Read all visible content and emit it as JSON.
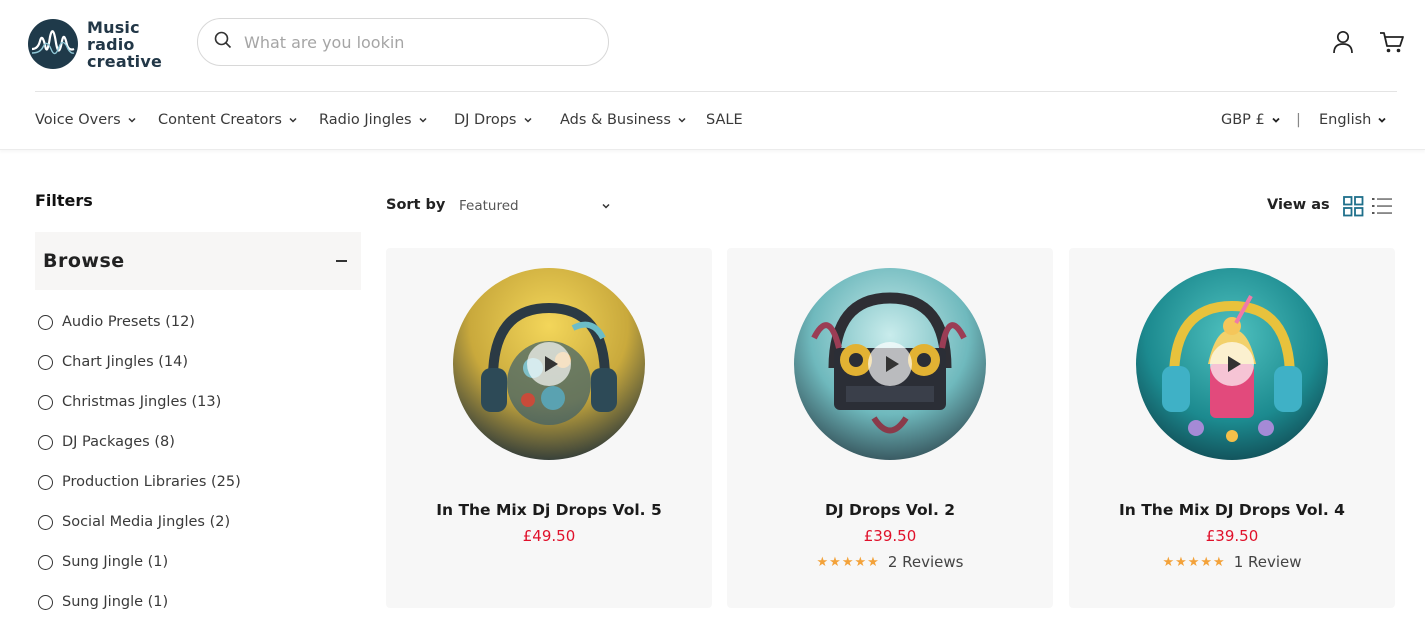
{
  "brand": {
    "logo_lines": [
      "Music",
      "radio",
      "creative"
    ],
    "accent": "#1f3a4a"
  },
  "search": {
    "placeholder": "What are you lookin"
  },
  "header_icons": [
    "account-icon",
    "cart-icon"
  ],
  "nav": {
    "items": [
      {
        "label": "Voice Overs",
        "dropdown": true
      },
      {
        "label": "Content Creators",
        "dropdown": true
      },
      {
        "label": "Radio Jingles",
        "dropdown": true
      },
      {
        "label": "DJ Drops",
        "dropdown": true
      },
      {
        "label": "Ads & Business",
        "dropdown": true
      },
      {
        "label": "SALE",
        "dropdown": false
      }
    ],
    "currency": "GBP £",
    "separator": "|",
    "language": "English"
  },
  "sidebar": {
    "filters_title": "Filters",
    "browse_title": "Browse",
    "items": [
      {
        "label": "Audio Presets (12)"
      },
      {
        "label": "Chart Jingles (14)"
      },
      {
        "label": "Christmas Jingles (13)"
      },
      {
        "label": "DJ Packages (8)"
      },
      {
        "label": "Production Libraries (25)"
      },
      {
        "label": "Social Media Jingles (2)"
      },
      {
        "label": "Sung Jingle (1)"
      },
      {
        "label": "Sung Jingle (1)"
      }
    ]
  },
  "toolbar": {
    "sort_label": "Sort by",
    "sort_value": "Featured",
    "view_label": "View as",
    "active_view": "grid",
    "active_color": "#1e6f8a"
  },
  "products": [
    {
      "title": "In The Mix Dj Drops Vol. 5",
      "price": "£49.50",
      "rating": 0,
      "reviews": ""
    },
    {
      "title": "DJ Drops Vol. 2",
      "price": "£39.50",
      "rating": 5,
      "reviews": "2 Reviews"
    },
    {
      "title": "In The Mix DJ Drops Vol. 4",
      "price": "£39.50",
      "rating": 5,
      "reviews": "1 Review"
    }
  ],
  "colors": {
    "price": "#e0112b",
    "stars": "#f3a23a",
    "card_bg": "#f7f7f7"
  }
}
